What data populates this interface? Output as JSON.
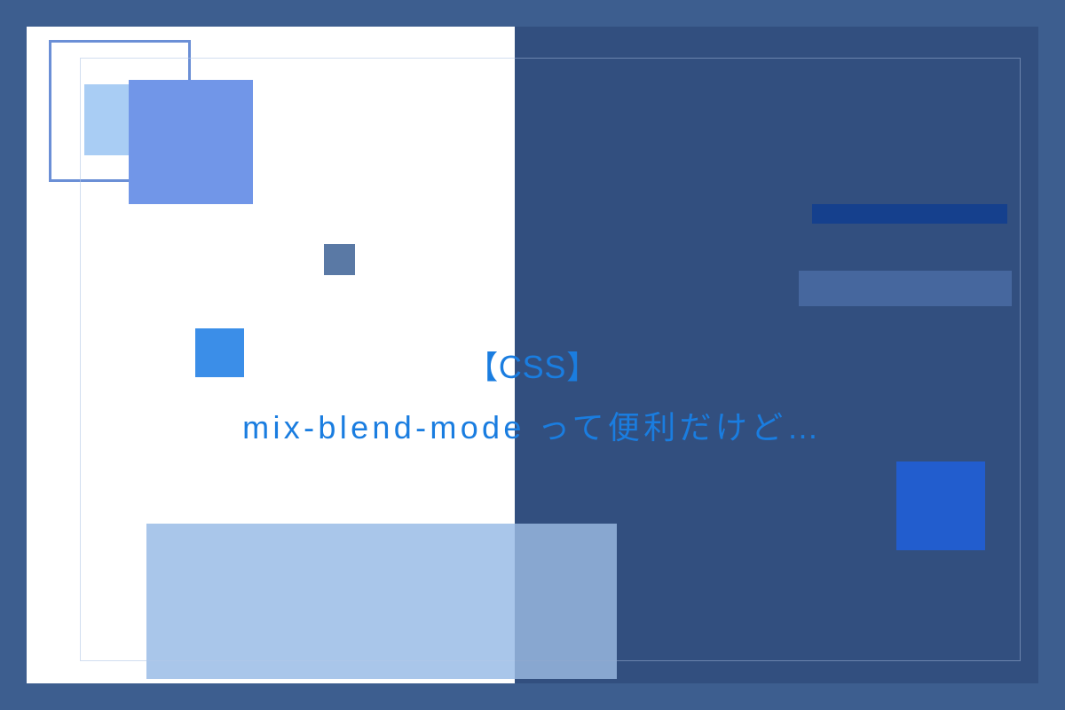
{
  "title": {
    "line1": "【CSS】",
    "line2": "mix-blend-mode って便利だけど…"
  },
  "colors": {
    "background": "#3d5e8f",
    "panel": "#ffffff",
    "text": "#1a7de0",
    "accent_bright": "#2a6ee8",
    "accent_light": "#a9cdf4",
    "accent_mid": "#7196e8",
    "bar_dark": "#1a4c9e"
  }
}
